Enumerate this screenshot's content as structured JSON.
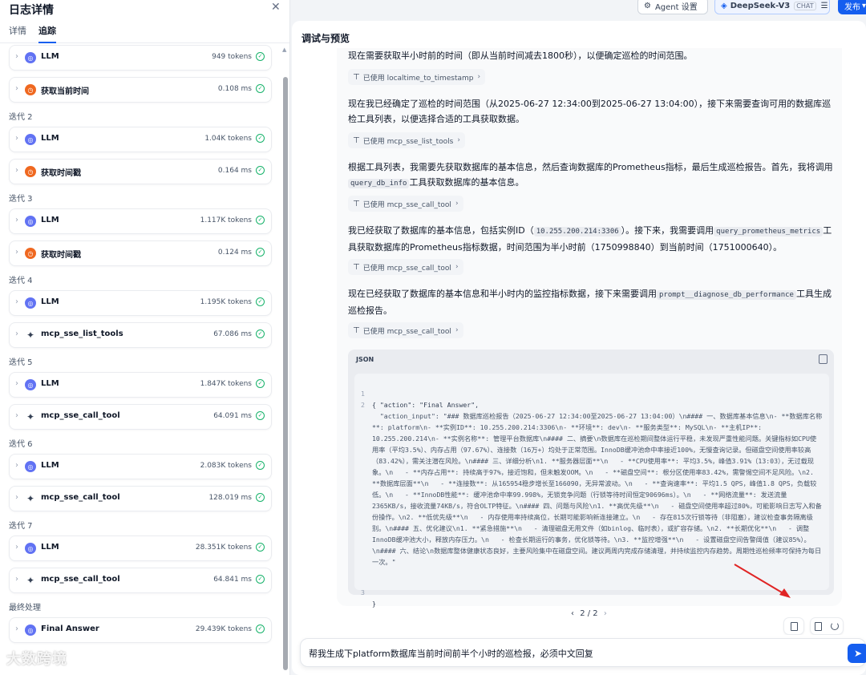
{
  "left_panel": {
    "title": "日志详情",
    "close_icon": "close-icon",
    "tabs": [
      {
        "label": "详情"
      },
      {
        "label": "追踪"
      }
    ],
    "groups": [
      {
        "label": "",
        "rows": [
          {
            "name": "LLM",
            "metric": "949 tokens",
            "icon": "llm-icon"
          },
          {
            "name": "获取当前时间",
            "metric": "0.108 ms",
            "icon": "clock-icon"
          }
        ]
      },
      {
        "label": "迭代 2",
        "rows": [
          {
            "name": "LLM",
            "metric": "1.04K tokens",
            "icon": "llm-icon"
          },
          {
            "name": "获取时间戳",
            "metric": "0.164 ms",
            "icon": "clock-icon"
          }
        ]
      },
      {
        "label": "迭代 3",
        "rows": [
          {
            "name": "LLM",
            "metric": "1.117K tokens",
            "icon": "llm-icon"
          },
          {
            "name": "获取时间戳",
            "metric": "0.124 ms",
            "icon": "clock-icon"
          }
        ]
      },
      {
        "label": "迭代 4",
        "rows": [
          {
            "name": "LLM",
            "metric": "1.195K tokens",
            "icon": "llm-icon"
          },
          {
            "name": "mcp_sse_list_tools",
            "metric": "67.086 ms",
            "icon": "tool-icon"
          }
        ]
      },
      {
        "label": "迭代 5",
        "rows": [
          {
            "name": "LLM",
            "metric": "1.847K tokens",
            "icon": "llm-icon"
          },
          {
            "name": "mcp_sse_call_tool",
            "metric": "64.091 ms",
            "icon": "tool-icon"
          }
        ]
      },
      {
        "label": "迭代 6",
        "rows": [
          {
            "name": "LLM",
            "metric": "2.083K tokens",
            "icon": "llm-icon"
          },
          {
            "name": "mcp_sse_call_tool",
            "metric": "128.019 ms",
            "icon": "tool-icon"
          }
        ]
      },
      {
        "label": "迭代 7",
        "rows": [
          {
            "name": "LLM",
            "metric": "28.351K tokens",
            "icon": "llm-icon"
          },
          {
            "name": "mcp_sse_call_tool",
            "metric": "64.841 ms",
            "icon": "tool-icon"
          }
        ]
      },
      {
        "label": "最终处理",
        "rows": [
          {
            "name": "Final Answer",
            "metric": "29.439K tokens",
            "icon": "llm-icon"
          }
        ]
      }
    ],
    "watermark": "大数跨境"
  },
  "topbar": {
    "agent_settings": "Agent 设置",
    "model": "DeepSeek-V3",
    "model_tag": "CHAT",
    "publish": "发布"
  },
  "main": {
    "title": "调试与预览",
    "paragraphs": {
      "p1": "现在需要获取半小时前的时间（即从当前时间减去1800秒），以便确定巡检的时间范围。",
      "p2": "现在我已经确定了巡检的时间范围（从2025-06-27 12:34:00到2025-06-27 13:04:00），接下来需要查询可用的数据库巡检工具列表，以便选择合适的工具获取数据。",
      "p3a": "根据工具列表，我需要先获取数据库的基本信息，然后查询数据库的Prometheus指标，最后生成巡检报告。首先，我将调用",
      "p3code": "query_db_info",
      "p3b": "工具获取数据库的基本信息。",
      "p4a": "我已经获取了数据库的基本信息，包括实例ID（",
      "p4code1": "10.255.200.214:3306",
      "p4b": "）。接下来，我需要调用",
      "p4code2": "query_prometheus_metrics",
      "p4c": "工具获取数据库的Prometheus指标数据，时间范围为半小时前（1750998840）到当前时间（1751000640）。",
      "p5a": "现在已经获取了数据库的基本信息和半小时内的监控指标数据，接下来需要调用",
      "p5code": "prompt__diagnose_db_performance",
      "p5b": "工具生成巡检报告。"
    },
    "tool_chips": [
      {
        "label": "已使用 localtime_to_timestamp"
      },
      {
        "label": "已使用 mcp_sse_list_tools"
      },
      {
        "label": "已使用 mcp_sse_call_tool"
      },
      {
        "label": "已使用 mcp_sse_call_tool"
      },
      {
        "label": "已使用 mcp_sse_call_tool"
      }
    ],
    "json_block": {
      "header": "JSON",
      "lines": [
        {
          "no": "1",
          "text": "{ \"action\": \"Final Answer\","
        },
        {
          "no": "2",
          "text": "  \"action_input\": \"### 数据库巡检报告（2025-06-27 12:34:00至2025-06-27 13:04:00）\\n#### 一、数据库基本信息\\n- **数据库名称**: platform\\n- **实例ID**: 10.255.200.214:3306\\n- **环境**: dev\\n- **服务类型**: MySQL\\n- **主机IP**: 10.255.200.214\\n- **实例名称**: 管理平台数据库\\n#### 二、摘要\\n数据库在巡检期间整体运行平稳，未发现严重性能问题。关键指标如CPU使用率（平均3.5%）、内存占用（97.67%）、连接数（16万+）均处于正常范围。InnoDB缓冲池命中率接近100%，无慢查询记录。但磁盘空间使用率较高（83.42%），需关注潜在风险。\\n#### 三、详细分析\\n1. **服务器层面**\\n   - **CPU使用率**: 平均3.5%，峰值3.91%（13:03），无过载现象。\\n   - **内存占用**: 持续高于97%，接近饱和，但未触发OOM。\\n   - **磁盘空间**: 根分区使用率83.42%，需警惕空间不足风险。\\n2. **数据库层面**\\n   - **连接数**: 从165954稳步增长至166090，无异常波动。\\n   - **查询速率**: 平均1.5 QPS，峰值1.8 QPS，负载较低。\\n   - **InnoDB性能**: 缓冲池命中率99.998%，无锁竞争问题（行锁等待时间恒定90696ms）。\\n   - **网络流量**: 发送流量2365KB/s，接收流量74KB/s，符合OLTP特征。\\n#### 四、问题与风险\\n1. **高优先级**\\n   - 磁盘空间使用率超过80%，可能影响日志写入和备份操作。\\n2. **低优先级**\\n   - 内存使用率持续高位，长期可能影响新连接建立。\\n   - 存在815次行锁等待（非阻塞），建议检查事务隔离级别。\\n#### 五、优化建议\\n1. **紧急措施**\\n   - 清理磁盘无用文件（如binlog、临时表），或扩容存储。\\n2. **长期优化**\\n   - 调整InnoDB缓冲池大小，释放内存压力。\\n   - 检查长期运行的事务，优化锁等待。\\n3. **监控增强**\\n   - 设置磁盘空间告警阈值（建议85%）。\\n#### 六、结论\\n数据库整体健康状态良好，主要风险集中在磁盘空间。建议两周内完成存储清理，并持续监控内存趋势。周期性巡检频率可保持为每日一次。\""
        },
        {
          "no": "3",
          "text": "}"
        }
      ]
    },
    "pager": {
      "prev": "‹",
      "text": "2 / 2",
      "next": "›"
    },
    "input": {
      "value": "帮我生成下platform数据库当前时间前半个小时的巡检报，必须中文回复"
    },
    "colors": {
      "accent": "#155eef",
      "success": "#17b26a",
      "clock": "#ef6820",
      "llm": "#6172f3",
      "annotation_arrow": "#e02424"
    }
  }
}
